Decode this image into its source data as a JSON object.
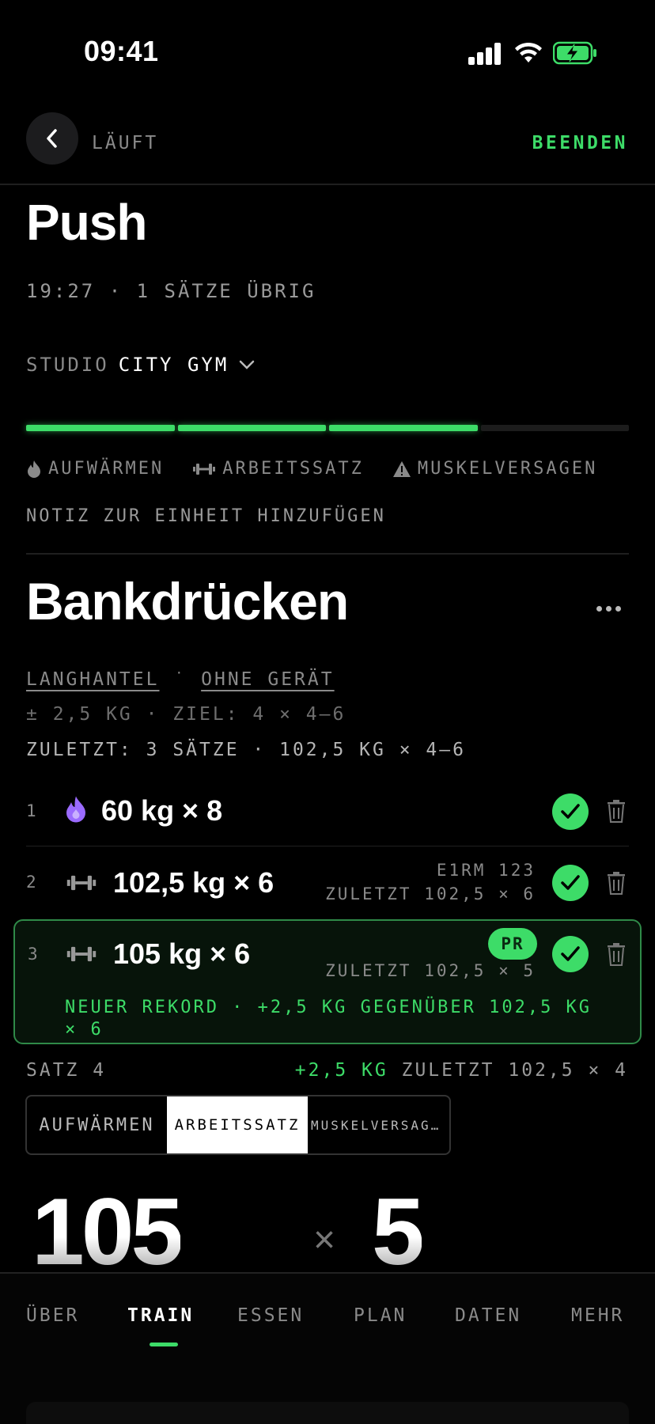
{
  "status_bar": {
    "time": "09:41"
  },
  "header": {
    "status": "LÄUFT",
    "end_label": "BEENDEN"
  },
  "workout": {
    "title": "Push",
    "meta": "19:27 · 1 SÄTZE ÜBRIG",
    "studio_label": "STUDIO",
    "studio_value": "CITY GYM",
    "progress": {
      "done_segments": 3,
      "total_segments": 4
    },
    "legend": [
      "AUFWÄRMEN",
      "ARBEITSSATZ",
      "MUSKELVERSAGEN"
    ],
    "note": "NOTIZ ZUR EINHEIT HINZUFÜGEN"
  },
  "exercise": {
    "name": "Bankdrücken",
    "tag1": "LANGHANTEL",
    "tag_sep": "·",
    "tag2": "OHNE GERÄT",
    "increment": "± 2,5 KG · ZIEL: 4 × 4–6",
    "last": "ZULETZT: 3 SÄTZE · 102,5 KG × 4–6"
  },
  "sets": [
    {
      "index": "1",
      "type": "warmup",
      "value": "60 kg × 8",
      "meta1": "",
      "meta2": ""
    },
    {
      "index": "2",
      "type": "work",
      "value": "102,5 kg × 6",
      "meta1": "E1RM 123",
      "meta2": "ZULETZT 102,5 × 6"
    },
    {
      "index": "3",
      "type": "work",
      "value": "105 kg × 6",
      "meta1": "",
      "meta2": "ZULETZT 102,5 × 5",
      "badge": "PR",
      "record": "NEUER REKORD · +2,5 KG GEGENÜBER 102,5 KG × 6"
    }
  ],
  "next_set": {
    "label": "SATZ 4",
    "delta": "+2,5 KG",
    "hint": "ZULETZT 102,5 × 4",
    "types": [
      "AUFWÄRMEN",
      "ARBEITSSATZ",
      "MUSKELVERSAG…"
    ],
    "selected_type": "ARBEITSSATZ",
    "weight": "105",
    "times": "×",
    "reps": "5"
  },
  "tabs": [
    {
      "label": "ÜBER",
      "active": false
    },
    {
      "label": "TRAIN",
      "active": true
    },
    {
      "label": "ESSEN",
      "active": false
    },
    {
      "label": "PLAN",
      "active": false
    },
    {
      "label": "DATEN",
      "active": false
    },
    {
      "label": "MEHR",
      "active": false
    }
  ],
  "colors": {
    "accent": "#3ddc68",
    "warmup": "#9b6bff",
    "background": "#000000"
  }
}
